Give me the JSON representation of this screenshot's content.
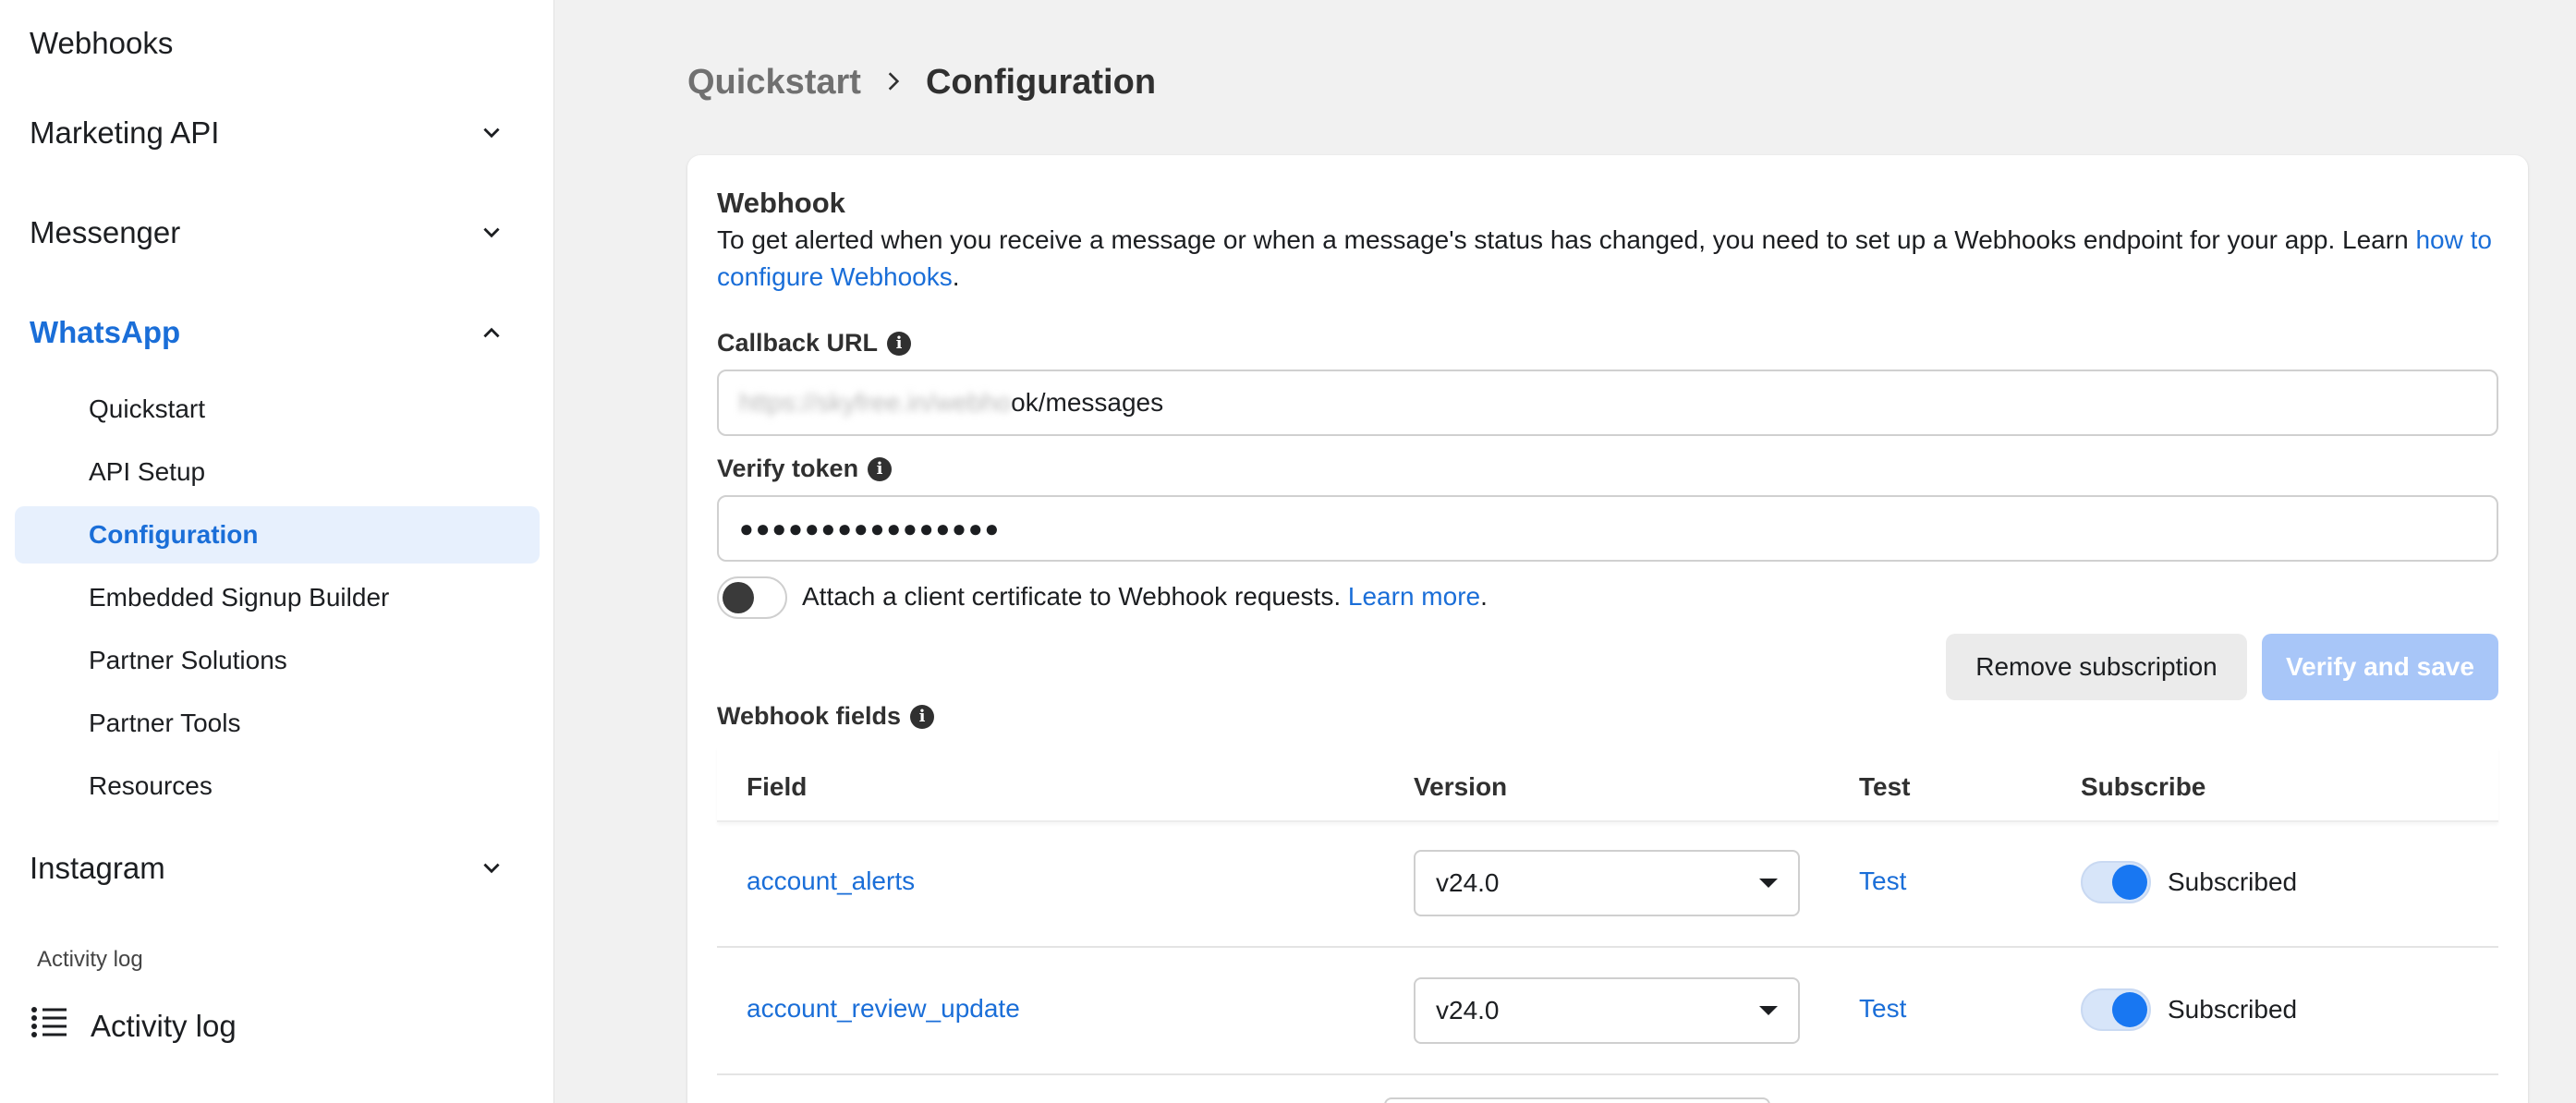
{
  "sidebar": {
    "top_item": "Webhooks",
    "sections": {
      "marketing_api": "Marketing API",
      "messenger": "Messenger",
      "whatsapp": "WhatsApp",
      "instagram": "Instagram"
    },
    "whatsapp_items": [
      "Quickstart",
      "API Setup",
      "Configuration",
      "Embedded Signup Builder",
      "Partner Solutions",
      "Partner Tools",
      "Resources"
    ],
    "selected_item": "Configuration",
    "activity_caption": "Activity log",
    "activity_item": "Activity log"
  },
  "breadcrumb": {
    "parent": "Quickstart",
    "current": "Configuration"
  },
  "webhook": {
    "title": "Webhook",
    "description": "To get alerted when you receive a message or when a message's status has changed, you need to set up a Webhooks endpoint for your app. Learn ",
    "description_link": "how to configure Webhooks",
    "description_end": ".",
    "callback_label": "Callback URL",
    "callback_url_blurred": "https://skyfree.in/webho",
    "callback_url_visible": "ok/messages",
    "verify_label": "Verify token",
    "verify_value": "●●●●●●●●●●●●●●●●",
    "cert_text": "Attach a client certificate to Webhook requests. ",
    "cert_link": "Learn more",
    "cert_end": ".",
    "cert_enabled": false,
    "remove_button": "Remove subscription",
    "verify_button": "Verify and save"
  },
  "webhook_fields": {
    "label": "Webhook fields",
    "columns": {
      "field": "Field",
      "version": "Version",
      "test": "Test",
      "subscribe": "Subscribe"
    },
    "rows": [
      {
        "field": "account_alerts",
        "version": "v24.0",
        "test": "Test",
        "status": "Subscribed"
      },
      {
        "field": "account_review_update",
        "version": "v24.0",
        "test": "Test",
        "status": "Subscribed"
      }
    ]
  },
  "colors": {
    "accent": "#1a6ed8",
    "toggle_on": "#1877f2",
    "verify_disabled": "#a8c6f8"
  }
}
